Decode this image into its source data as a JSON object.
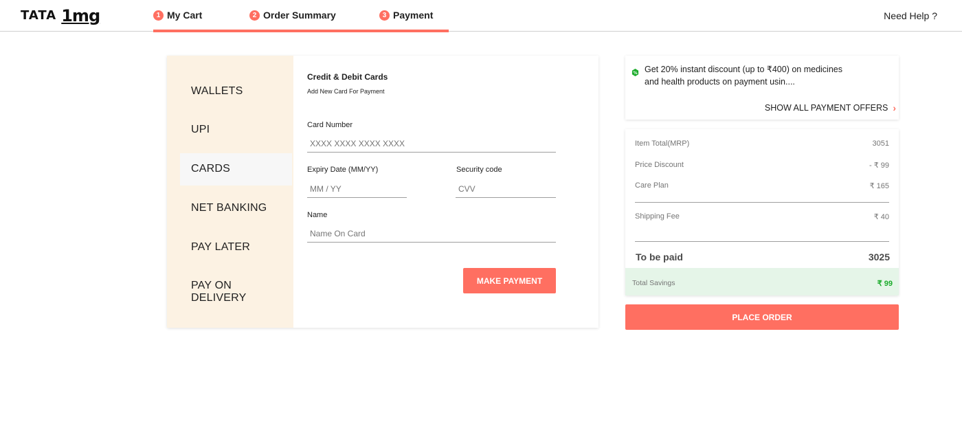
{
  "header": {
    "logo_tata": "TATA",
    "logo_1mg": "1mg",
    "steps": [
      {
        "num": "1",
        "label": "My Cart"
      },
      {
        "num": "2",
        "label": "Order Summary"
      },
      {
        "num": "3",
        "label": "Payment"
      }
    ],
    "help": "Need Help ?"
  },
  "methods": [
    "WALLETS",
    "UPI",
    "CARDS",
    "NET BANKING",
    "PAY LATER",
    "PAY ON DELIVERY"
  ],
  "active_method": "CARDS",
  "form": {
    "title": "Credit & Debit Cards",
    "subtitle": "Add New Card For Payment",
    "card_number_label": "Card Number",
    "card_number_placeholder": "XXXX XXXX XXXX XXXX",
    "expiry_label": "Expiry Date (MM/YY)",
    "expiry_placeholder": "MM / YY",
    "cvv_label": "Security code",
    "cvv_placeholder": "CVV",
    "name_label": "Name",
    "name_placeholder": "Name On Card",
    "submit_label": "MAKE PAYMENT"
  },
  "offer": {
    "text": "Get 20% instant discount (up to ₹400) on medicines and health products on payment usin....",
    "link": "SHOW ALL PAYMENT OFFERS"
  },
  "summary": {
    "rows": [
      {
        "label": "Item Total(MRP)",
        "value": "3051"
      },
      {
        "label": "Price Discount",
        "value": "- ₹ 99"
      },
      {
        "label": "Care Plan",
        "value": "₹ 165"
      },
      {
        "label": "Shipping Fee",
        "value": "₹ 40"
      }
    ],
    "total_label": "To be paid",
    "total_value": "3025",
    "savings_label": "Total Savings",
    "savings_value": "₹ 99"
  },
  "place_order": "PLACE ORDER",
  "colors": {
    "accent": "#ff6f61",
    "sidebar_bg": "#fcf2e3",
    "savings_bg": "#e5f5e8",
    "savings_text": "#1aab2a"
  }
}
